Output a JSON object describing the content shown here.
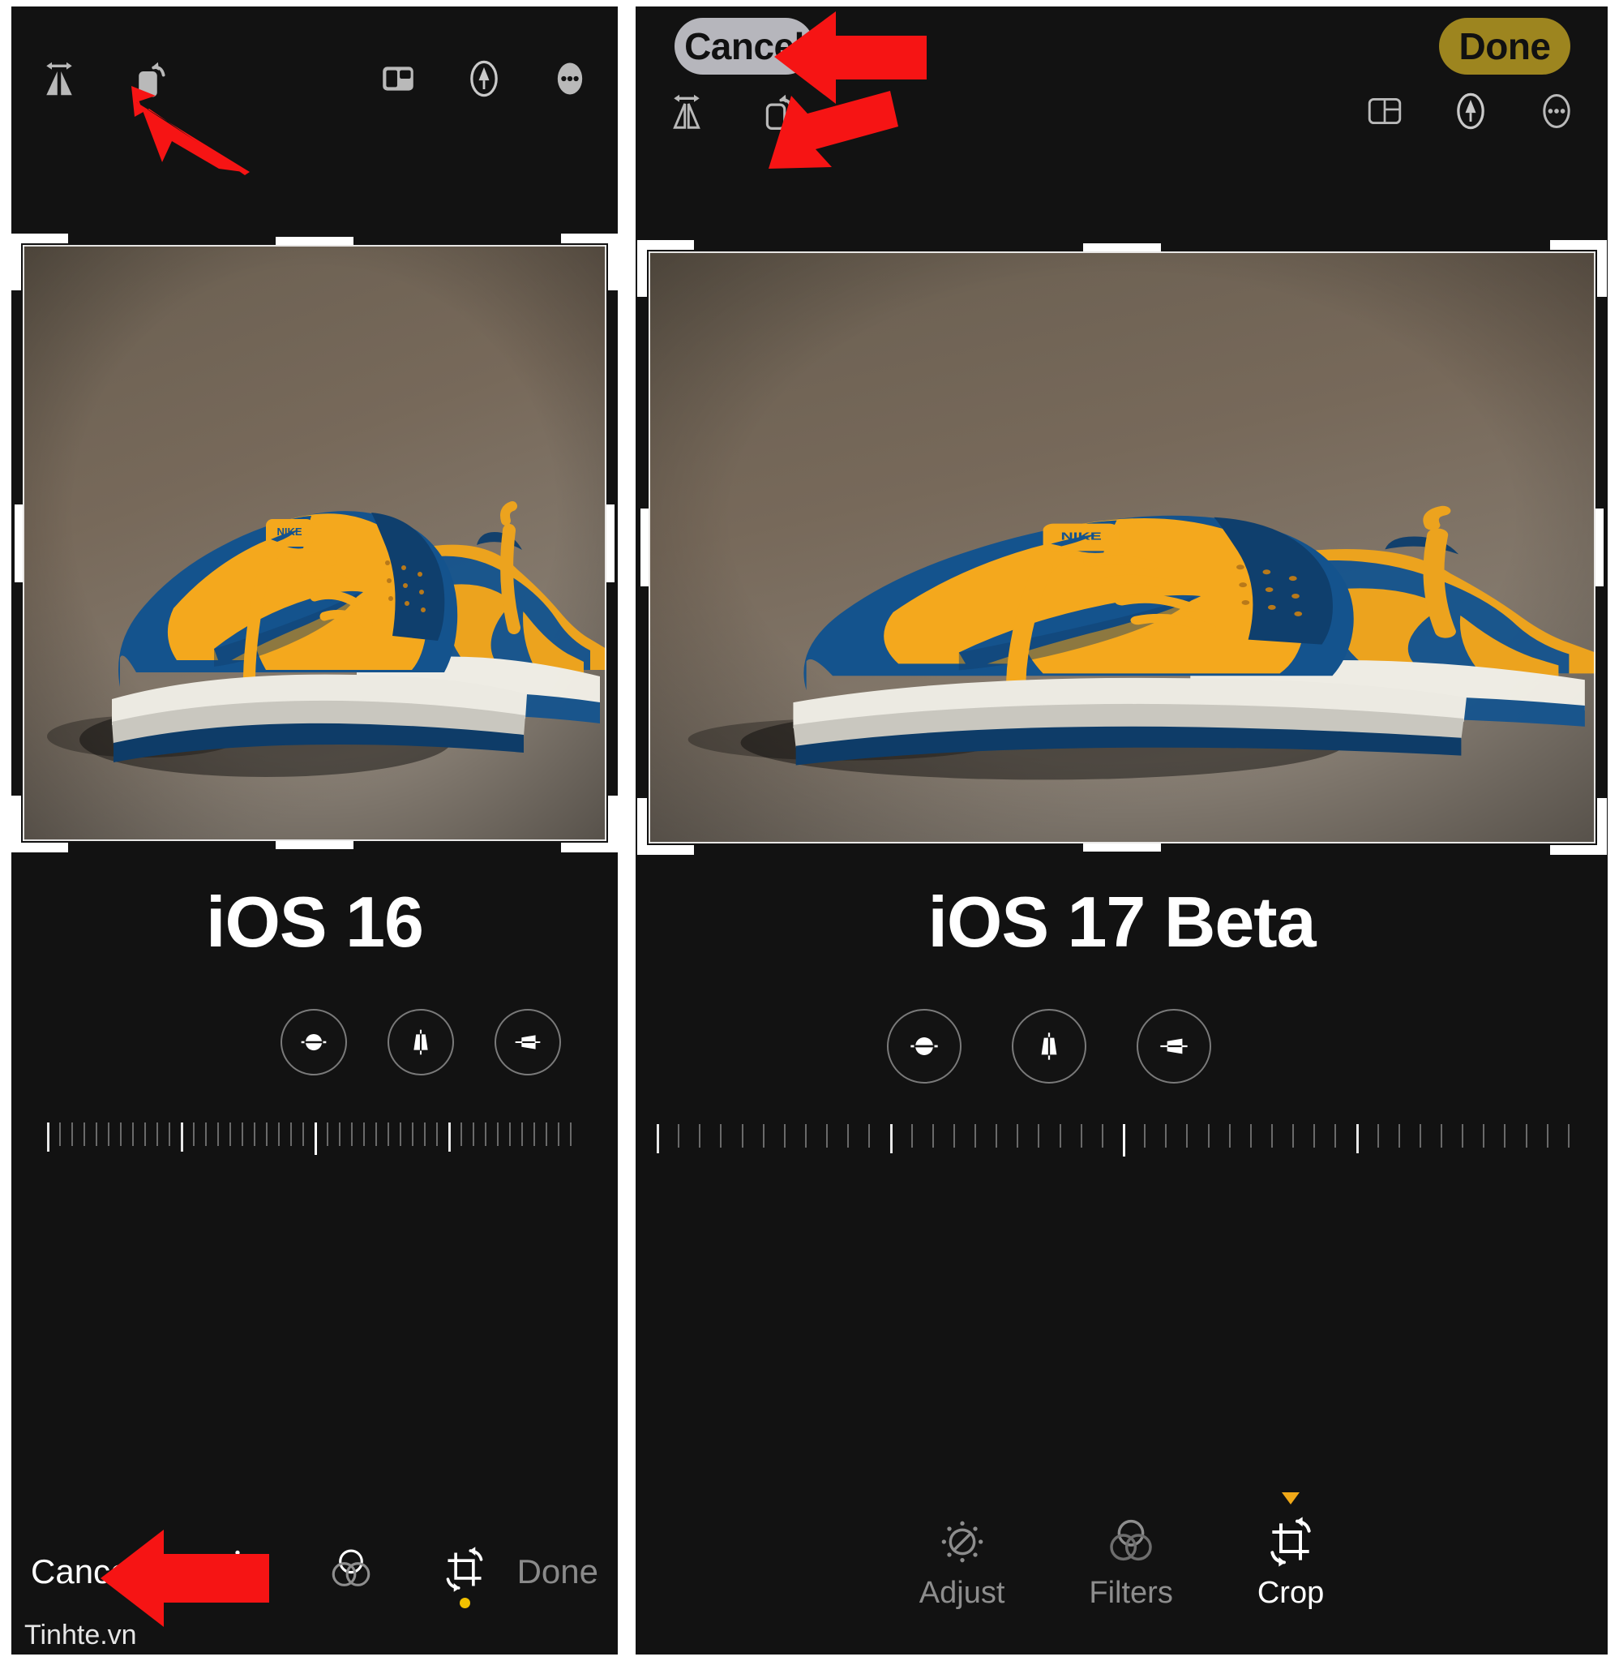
{
  "meta": {
    "watermark": "Tinhte.vn",
    "accent_yellow": "#f0a818",
    "accent_gold": "#9d851f",
    "arrow_red": "#f61414",
    "panel_bg": "#121212",
    "photo_bg": "#6d6253"
  },
  "left_panel": {
    "caption": "iOS 16",
    "top_toolbar": {
      "left_icons": [
        {
          "name": "flip-horizontal-icon",
          "label": "Flip"
        },
        {
          "name": "rotate-left-icon",
          "label": "Rotate"
        }
      ],
      "right_icons": [
        {
          "name": "aspect-ratio-icon",
          "label": "Aspect Ratio"
        },
        {
          "name": "markup-pen-icon",
          "label": "Markup"
        },
        {
          "name": "more-ellipsis-icon",
          "label": "More"
        }
      ]
    },
    "geometry_controls": [
      {
        "name": "straighten-icon",
        "label": "Straighten",
        "active": true
      },
      {
        "name": "vertical-perspective-icon",
        "label": "Vertical",
        "active": false
      },
      {
        "name": "horizontal-perspective-icon",
        "label": "Horizontal",
        "active": false
      }
    ],
    "slider": {
      "name": "straighten-ruler",
      "value": 0,
      "min": -45,
      "max": 45,
      "ticks": 45,
      "center_index": 22
    },
    "bottom_bar": {
      "cancel_label": "Cancel",
      "done_label": "Done",
      "tools": [
        {
          "name": "adjust-icon",
          "label": "Adjust",
          "active": false,
          "badge": false
        },
        {
          "name": "filters-icon",
          "label": "Filters",
          "active": false,
          "badge": false
        },
        {
          "name": "crop-icon",
          "label": "Crop",
          "active": true,
          "badge": true
        }
      ]
    }
  },
  "right_panel": {
    "caption": "iOS 17 Beta",
    "top_bar": {
      "cancel_label": "Cancel",
      "done_label": "Done"
    },
    "top_toolbar": {
      "left_icons": [
        {
          "name": "flip-horizontal-icon",
          "label": "Flip"
        },
        {
          "name": "rotate-left-icon",
          "label": "Rotate"
        }
      ],
      "right_icons": [
        {
          "name": "aspect-ratio-icon",
          "label": "Aspect Ratio"
        },
        {
          "name": "markup-pen-icon",
          "label": "Markup"
        },
        {
          "name": "more-ellipsis-icon",
          "label": "More"
        }
      ]
    },
    "geometry_controls": [
      {
        "name": "straighten-icon",
        "label": "Straighten",
        "active": true
      },
      {
        "name": "vertical-perspective-icon",
        "label": "Vertical",
        "active": false
      },
      {
        "name": "horizontal-perspective-icon",
        "label": "Horizontal",
        "active": false
      }
    ],
    "slider": {
      "name": "straighten-ruler",
      "value": 0,
      "min": -45,
      "max": 45,
      "ticks": 45,
      "center_index": 22
    },
    "tab_bar": {
      "tabs": [
        {
          "name": "tab-adjust",
          "label": "Adjust",
          "active": false
        },
        {
          "name": "tab-filters",
          "label": "Filters",
          "active": false
        },
        {
          "name": "tab-crop",
          "label": "Crop",
          "active": true
        }
      ]
    }
  },
  "annotations": [
    {
      "name": "arrow-to-rotate-left-panel",
      "points_to": "rotate-left-icon"
    },
    {
      "name": "arrow-to-cancel-right-panel",
      "points_to": "cancel-button"
    },
    {
      "name": "arrow-to-rotate-right-panel",
      "points_to": "rotate-left-icon"
    },
    {
      "name": "arrow-to-cancel-left-panel",
      "points_to": "cancel-button"
    }
  ],
  "photo": {
    "name": "nike-dunk-low-sneakers-photo",
    "subject": "Blue and yellow Nike Dunk Low sneakers on a brown backdrop"
  }
}
